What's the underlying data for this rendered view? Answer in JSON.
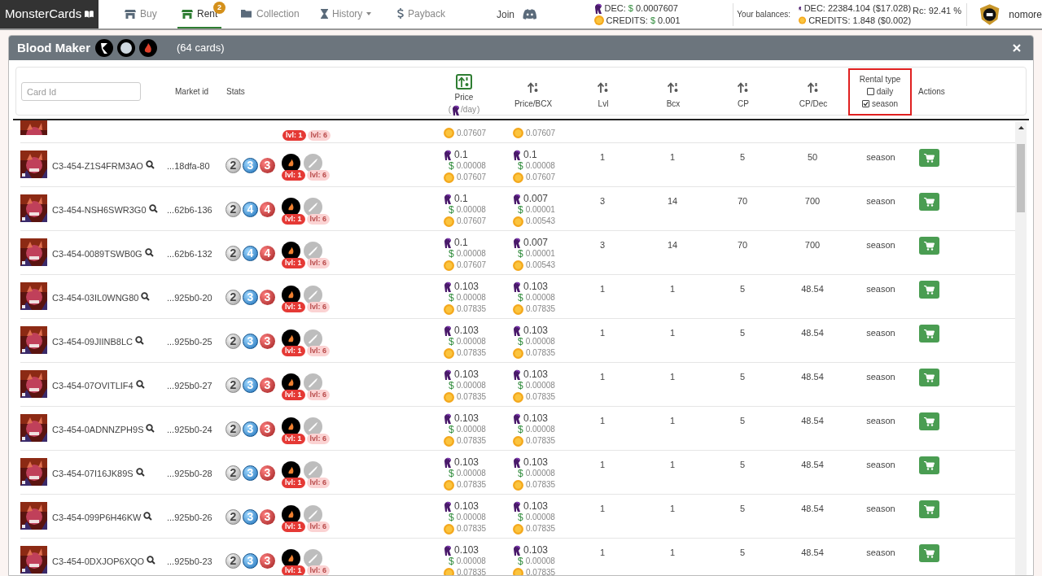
{
  "navbar": {
    "brand": "MonsterCards",
    "items": [
      {
        "label": "Buy",
        "selected": false
      },
      {
        "label": "Rent",
        "selected": true,
        "badge": "2"
      },
      {
        "label": "Collection",
        "selected": false
      },
      {
        "label": "History",
        "selected": false,
        "dropdown": true
      },
      {
        "label": "Payback",
        "selected": false
      }
    ],
    "join": "Join",
    "prices": [
      {
        "kind": "dec",
        "label": "DEC:",
        "currency": "$",
        "amount": "0.0007607"
      },
      {
        "kind": "credits",
        "label": "CREDITS:",
        "currency": "$",
        "amount": "0.001"
      }
    ],
    "balances_label": "Your balances:",
    "balances": [
      {
        "kind": "dec",
        "text": "DEC: 22384.104 ($17.028)"
      },
      {
        "kind": "credits",
        "text": "CREDITS: 1.848 ($0.002)"
      }
    ],
    "rc": "Rc: 92.41 %",
    "username": "nomore"
  },
  "modal": {
    "title": "Blood Maker",
    "elements": [
      {
        "kind": "neutral"
      },
      {
        "kind": "water"
      },
      {
        "kind": "fire"
      }
    ],
    "count": "(64 cards)",
    "columns": {
      "card_id_placeholder": "Card Id",
      "market_id": "Market id",
      "stats": "Stats",
      "sortable": [
        {
          "label": "Price",
          "sub_open": "(",
          "sub": "/day",
          "sub_close": ")",
          "selected": true
        },
        {
          "label": "Price/BCX",
          "selected": false
        },
        {
          "label": "Lvl",
          "selected": false
        },
        {
          "label": "Bcx",
          "selected": false
        },
        {
          "label": "CP",
          "selected": false
        },
        {
          "label": "CP/Dec",
          "selected": false
        }
      ],
      "rental_type": {
        "label": "Rental type",
        "options": [
          {
            "label": "daily",
            "checked": false
          },
          {
            "label": "season",
            "checked": true
          }
        ]
      },
      "actions": "Actions"
    },
    "partial_row": {
      "price_credits": "0.07607",
      "bcx_credits": "0.07607",
      "abilities": [
        {
          "label": "lvl: 1",
          "unlocked": true
        },
        {
          "label": "lvl: 6",
          "unlocked": false
        }
      ]
    },
    "rows": [
      {
        "card_id": "C3-454-Z1S4FRM3AO",
        "market_id": "...18dfa-80",
        "stats": [
          {
            "kind": "attack",
            "value": "2"
          },
          {
            "kind": "speed",
            "value": "3"
          },
          {
            "kind": "health",
            "value": "3"
          }
        ],
        "price": {
          "dec": "0.1",
          "usd_sign": "$",
          "usd": "0.00008",
          "credits": "0.07607"
        },
        "price_bcx": {
          "dec": "0.1",
          "usd_sign": "$",
          "usd": "0.00008",
          "credits": "0.07607"
        },
        "lvl": "1",
        "bcx": "1",
        "cp": "5",
        "cp_dec": "50",
        "rental_type": "season",
        "abilities": [
          {
            "label": "lvl: 1",
            "unlocked": true
          },
          {
            "label": "lvl: 6",
            "unlocked": false
          }
        ]
      },
      {
        "card_id": "C3-454-NSH6SWR3G0",
        "market_id": "...62b6-136",
        "stats": [
          {
            "kind": "attack",
            "value": "2"
          },
          {
            "kind": "speed",
            "value": "4"
          },
          {
            "kind": "health",
            "value": "4"
          }
        ],
        "price": {
          "dec": "0.1",
          "usd_sign": "$",
          "usd": "0.00008",
          "credits": "0.07607"
        },
        "price_bcx": {
          "dec": "0.007",
          "usd_sign": "$",
          "usd": "0.00001",
          "credits": "0.00543"
        },
        "lvl": "3",
        "bcx": "14",
        "cp": "70",
        "cp_dec": "700",
        "rental_type": "season",
        "abilities": [
          {
            "label": "lvl: 1",
            "unlocked": true
          },
          {
            "label": "lvl: 6",
            "unlocked": false
          }
        ]
      },
      {
        "card_id": "C3-454-0089TSWB0G",
        "market_id": "...62b6-132",
        "stats": [
          {
            "kind": "attack",
            "value": "2"
          },
          {
            "kind": "speed",
            "value": "4"
          },
          {
            "kind": "health",
            "value": "4"
          }
        ],
        "price": {
          "dec": "0.1",
          "usd_sign": "$",
          "usd": "0.00008",
          "credits": "0.07607"
        },
        "price_bcx": {
          "dec": "0.007",
          "usd_sign": "$",
          "usd": "0.00001",
          "credits": "0.00543"
        },
        "lvl": "3",
        "bcx": "14",
        "cp": "70",
        "cp_dec": "700",
        "rental_type": "season",
        "abilities": [
          {
            "label": "lvl: 1",
            "unlocked": true
          },
          {
            "label": "lvl: 6",
            "unlocked": false
          }
        ]
      },
      {
        "card_id": "C3-454-03IL0WNG80",
        "market_id": "...925b0-20",
        "stats": [
          {
            "kind": "attack",
            "value": "2"
          },
          {
            "kind": "speed",
            "value": "3"
          },
          {
            "kind": "health",
            "value": "3"
          }
        ],
        "price": {
          "dec": "0.103",
          "usd_sign": "$",
          "usd": "0.00008",
          "credits": "0.07835"
        },
        "price_bcx": {
          "dec": "0.103",
          "usd_sign": "$",
          "usd": "0.00008",
          "credits": "0.07835"
        },
        "lvl": "1",
        "bcx": "1",
        "cp": "5",
        "cp_dec": "48.54",
        "rental_type": "season",
        "abilities": [
          {
            "label": "lvl: 1",
            "unlocked": true
          },
          {
            "label": "lvl: 6",
            "unlocked": false
          }
        ]
      },
      {
        "card_id": "C3-454-09JIINB8LC",
        "market_id": "...925b0-25",
        "stats": [
          {
            "kind": "attack",
            "value": "2"
          },
          {
            "kind": "speed",
            "value": "3"
          },
          {
            "kind": "health",
            "value": "3"
          }
        ],
        "price": {
          "dec": "0.103",
          "usd_sign": "$",
          "usd": "0.00008",
          "credits": "0.07835"
        },
        "price_bcx": {
          "dec": "0.103",
          "usd_sign": "$",
          "usd": "0.00008",
          "credits": "0.07835"
        },
        "lvl": "1",
        "bcx": "1",
        "cp": "5",
        "cp_dec": "48.54",
        "rental_type": "season",
        "abilities": [
          {
            "label": "lvl: 1",
            "unlocked": true
          },
          {
            "label": "lvl: 6",
            "unlocked": false
          }
        ]
      },
      {
        "card_id": "C3-454-07OVITLIF4",
        "market_id": "...925b0-27",
        "stats": [
          {
            "kind": "attack",
            "value": "2"
          },
          {
            "kind": "speed",
            "value": "3"
          },
          {
            "kind": "health",
            "value": "3"
          }
        ],
        "price": {
          "dec": "0.103",
          "usd_sign": "$",
          "usd": "0.00008",
          "credits": "0.07835"
        },
        "price_bcx": {
          "dec": "0.103",
          "usd_sign": "$",
          "usd": "0.00008",
          "credits": "0.07835"
        },
        "lvl": "1",
        "bcx": "1",
        "cp": "5",
        "cp_dec": "48.54",
        "rental_type": "season",
        "abilities": [
          {
            "label": "lvl: 1",
            "unlocked": true
          },
          {
            "label": "lvl: 6",
            "unlocked": false
          }
        ]
      },
      {
        "card_id": "C3-454-0ADNNZPH9S",
        "market_id": "...925b0-24",
        "stats": [
          {
            "kind": "attack",
            "value": "2"
          },
          {
            "kind": "speed",
            "value": "3"
          },
          {
            "kind": "health",
            "value": "3"
          }
        ],
        "price": {
          "dec": "0.103",
          "usd_sign": "$",
          "usd": "0.00008",
          "credits": "0.07835"
        },
        "price_bcx": {
          "dec": "0.103",
          "usd_sign": "$",
          "usd": "0.00008",
          "credits": "0.07835"
        },
        "lvl": "1",
        "bcx": "1",
        "cp": "5",
        "cp_dec": "48.54",
        "rental_type": "season",
        "abilities": [
          {
            "label": "lvl: 1",
            "unlocked": true
          },
          {
            "label": "lvl: 6",
            "unlocked": false
          }
        ]
      },
      {
        "card_id": "C3-454-07I16JK89S",
        "market_id": "...925b0-28",
        "stats": [
          {
            "kind": "attack",
            "value": "2"
          },
          {
            "kind": "speed",
            "value": "3"
          },
          {
            "kind": "health",
            "value": "3"
          }
        ],
        "price": {
          "dec": "0.103",
          "usd_sign": "$",
          "usd": "0.00008",
          "credits": "0.07835"
        },
        "price_bcx": {
          "dec": "0.103",
          "usd_sign": "$",
          "usd": "0.00008",
          "credits": "0.07835"
        },
        "lvl": "1",
        "bcx": "1",
        "cp": "5",
        "cp_dec": "48.54",
        "rental_type": "season",
        "abilities": [
          {
            "label": "lvl: 1",
            "unlocked": true
          },
          {
            "label": "lvl: 6",
            "unlocked": false
          }
        ]
      },
      {
        "card_id": "C3-454-099P6H46KW",
        "market_id": "...925b0-26",
        "stats": [
          {
            "kind": "attack",
            "value": "2"
          },
          {
            "kind": "speed",
            "value": "3"
          },
          {
            "kind": "health",
            "value": "3"
          }
        ],
        "price": {
          "dec": "0.103",
          "usd_sign": "$",
          "usd": "0.00008",
          "credits": "0.07835"
        },
        "price_bcx": {
          "dec": "0.103",
          "usd_sign": "$",
          "usd": "0.00008",
          "credits": "0.07835"
        },
        "lvl": "1",
        "bcx": "1",
        "cp": "5",
        "cp_dec": "48.54",
        "rental_type": "season",
        "abilities": [
          {
            "label": "lvl: 1",
            "unlocked": true
          },
          {
            "label": "lvl: 6",
            "unlocked": false
          }
        ]
      },
      {
        "card_id": "C3-454-0DXJOP6XQO",
        "market_id": "...925b0-23",
        "stats": [
          {
            "kind": "attack",
            "value": "2"
          },
          {
            "kind": "speed",
            "value": "3"
          },
          {
            "kind": "health",
            "value": "3"
          }
        ],
        "price": {
          "dec": "0.103",
          "usd_sign": "$",
          "usd": "0.00008",
          "credits": "0.07835"
        },
        "price_bcx": {
          "dec": "0.103",
          "usd_sign": "$",
          "usd": "0.00008",
          "credits": "0.07835"
        },
        "lvl": "1",
        "bcx": "1",
        "cp": "5",
        "cp_dec": "48.54",
        "rental_type": "season",
        "abilities": [
          {
            "label": "lvl: 1",
            "unlocked": true
          },
          {
            "label": "lvl: 6",
            "unlocked": false
          }
        ]
      }
    ]
  }
}
